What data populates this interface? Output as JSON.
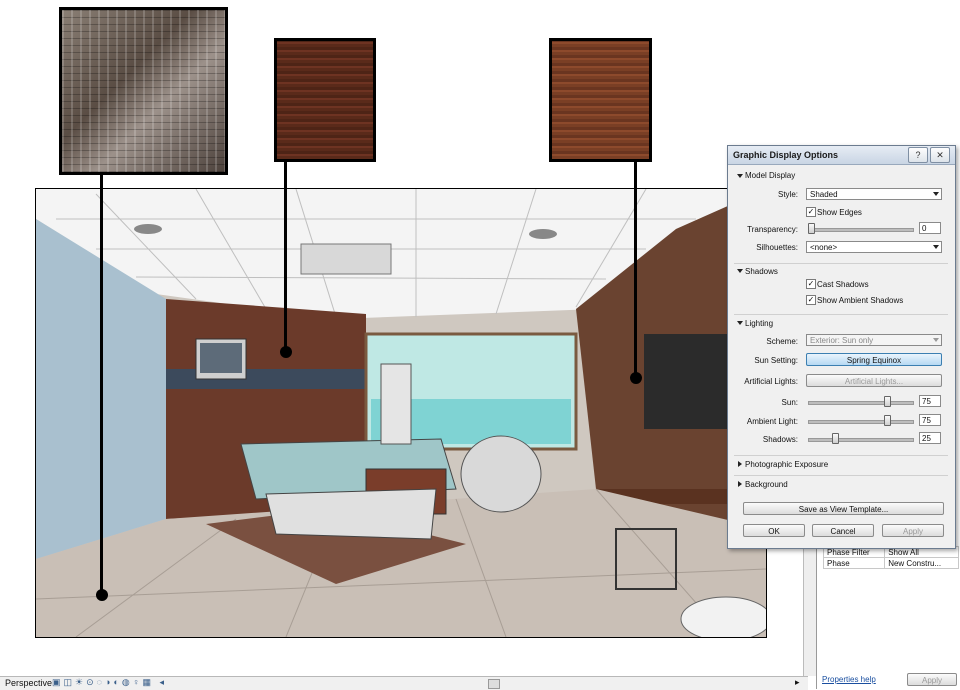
{
  "dialog": {
    "title": "Graphic Display Options",
    "help_button": "?",
    "close_button": "✕",
    "model_display": {
      "header": "Model Display",
      "style_label": "Style:",
      "style_value": "Shaded",
      "show_edges_label": "Show Edges",
      "show_edges_checked": true,
      "transparency_label": "Transparency:",
      "transparency_value": "0",
      "transparency_fraction": 0.0,
      "silhouettes_label": "Silhouettes:",
      "silhouettes_value": "<none>"
    },
    "shadows": {
      "header": "Shadows",
      "cast_shadows_label": "Cast Shadows",
      "cast_shadows_checked": true,
      "ambient_shadows_label": "Show Ambient Shadows",
      "ambient_shadows_checked": true
    },
    "lighting": {
      "header": "Lighting",
      "scheme_label": "Scheme:",
      "scheme_value": "Exterior: Sun only",
      "sun_setting_label": "Sun Setting:",
      "sun_setting_value": "Spring Equinox",
      "artificial_lights_label": "Artificial Lights:",
      "artificial_lights_button": "Artificial Lights...",
      "sun_label": "Sun:",
      "sun_value": "75",
      "ambient_light_label": "Ambient Light:",
      "ambient_light_value": "75",
      "shadows_label": "Shadows:",
      "shadows_value": "25"
    },
    "photographic_exposure_header": "Photographic Exposure",
    "background_header": "Background",
    "save_template_button": "Save as View Template...",
    "ok_button": "OK",
    "cancel_button": "Cancel",
    "apply_button": "Apply"
  },
  "properties": {
    "rows": [
      {
        "name": "Phase Filter",
        "value": "Show All"
      },
      {
        "name": "Phase",
        "value": "New Constru..."
      }
    ],
    "help_link": "Properties help",
    "apply_button": "Apply"
  },
  "status_bar": {
    "view_label": "Perspective"
  },
  "colors": {
    "dialog_bg": "#f0f0f0",
    "sun_setting_button": "#b7d9f3",
    "wall_blue": "#a9c0cf",
    "wood_panel": "#5a2a1a"
  }
}
